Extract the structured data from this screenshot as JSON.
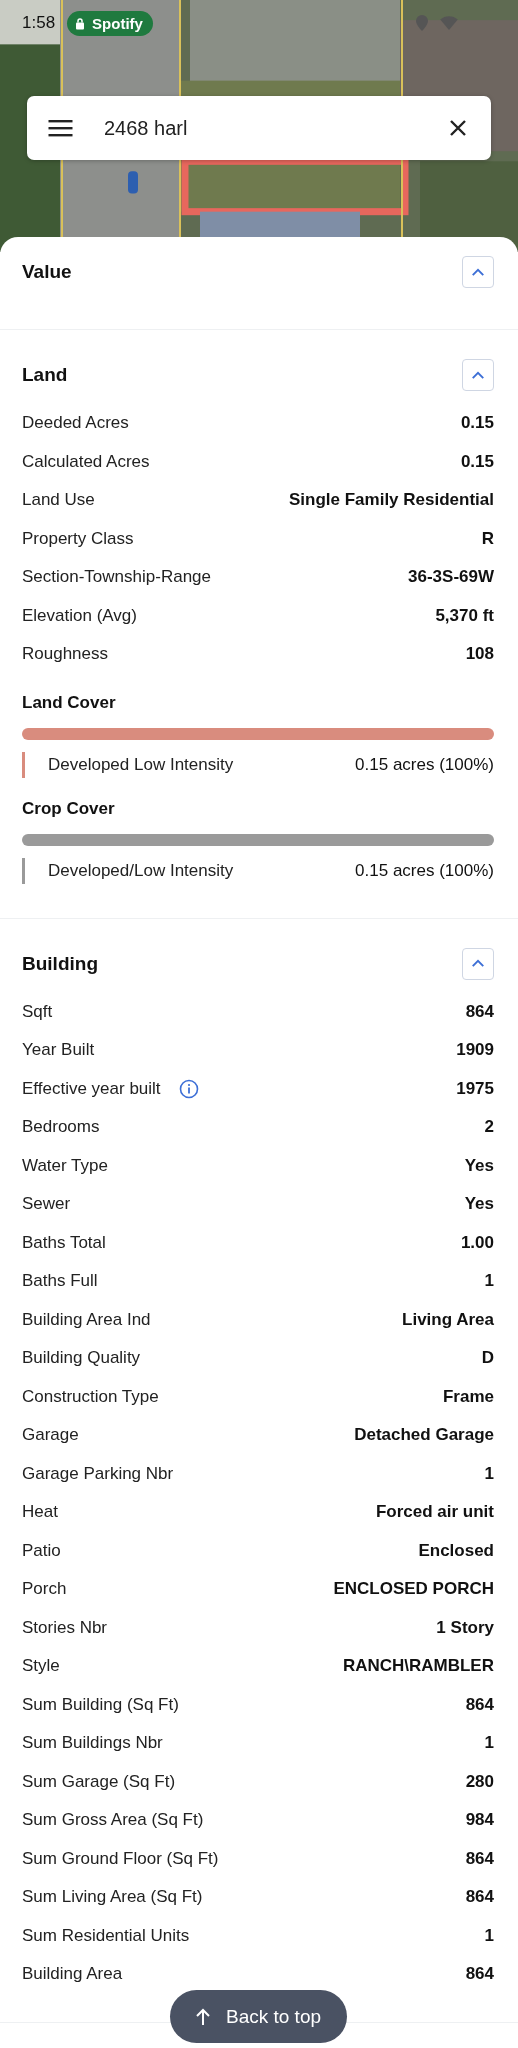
{
  "status_bar": {
    "time": "1:58",
    "app_chip": "Spotify"
  },
  "search": {
    "value": "2468 harl"
  },
  "sections": [
    {
      "title": "Value",
      "expanded": true
    },
    {
      "title": "Land",
      "expanded": true,
      "rows": [
        {
          "label": "Deeded Acres",
          "value": "0.15",
          "info": false
        },
        {
          "label": "Calculated Acres",
          "value": "0.15",
          "info": false
        },
        {
          "label": "Land Use",
          "value": "Single Family Residential",
          "info": false
        },
        {
          "label": "Property Class",
          "value": "R",
          "info": false
        },
        {
          "label": "Section-Township-Range",
          "value": "36-3S-69W",
          "info": false
        },
        {
          "label": "Elevation (Avg)",
          "value": "5,370 ft",
          "info": false
        },
        {
          "label": "Roughness",
          "value": "108",
          "info": false
        }
      ],
      "covers": [
        {
          "title": "Land Cover",
          "items": [
            {
              "name": "Developed Low Intensity",
              "amount": "0.15 acres (100%)",
              "level": 1,
              "color": "#d98c7e"
            }
          ]
        },
        {
          "title": "Crop Cover",
          "items": [
            {
              "name": "Developed/Low Intensity",
              "amount": "0.15 acres (100%)",
              "level": 1,
              "color": "#9a9a9a"
            }
          ]
        }
      ]
    },
    {
      "title": "Building",
      "expanded": true,
      "rows": [
        {
          "label": "Sqft",
          "value": "864",
          "info": false
        },
        {
          "label": "Year Built",
          "value": "1909",
          "info": false
        },
        {
          "label": "Effective year built",
          "value": "1975",
          "info": true
        },
        {
          "label": "Bedrooms",
          "value": "2",
          "info": false
        },
        {
          "label": "Water Type",
          "value": "Yes",
          "info": false
        },
        {
          "label": "Sewer",
          "value": "Yes",
          "info": false
        },
        {
          "label": "Baths Total",
          "value": "1.00",
          "info": false
        },
        {
          "label": "Baths Full",
          "value": "1",
          "info": false
        },
        {
          "label": "Building Area Ind",
          "value": "Living Area",
          "info": false
        },
        {
          "label": "Building Quality",
          "value": "D",
          "info": false
        },
        {
          "label": "Construction Type",
          "value": "Frame",
          "info": false
        },
        {
          "label": "Garage",
          "value": "Detached Garage",
          "info": false
        },
        {
          "label": "Garage Parking Nbr",
          "value": "1",
          "info": false
        },
        {
          "label": "Heat",
          "value": "Forced air unit",
          "info": false
        },
        {
          "label": "Patio",
          "value": "Enclosed",
          "info": false
        },
        {
          "label": "Porch",
          "value": "ENCLOSED PORCH",
          "info": false
        },
        {
          "label": "Stories Nbr",
          "value": "1 Story",
          "info": false
        },
        {
          "label": "Style",
          "value": "RANCH\\RAMBLER",
          "info": false
        },
        {
          "label": "Sum Building (Sq Ft)",
          "value": "864",
          "info": false
        },
        {
          "label": "Sum Buildings Nbr",
          "value": "1",
          "info": false
        },
        {
          "label": "Sum Garage (Sq Ft)",
          "value": "280",
          "info": false
        },
        {
          "label": "Sum Gross Area (Sq Ft)",
          "value": "984",
          "info": false
        },
        {
          "label": "Sum Ground Floor (Sq Ft)",
          "value": "864",
          "info": false
        },
        {
          "label": "Sum Living Area (Sq Ft)",
          "value": "864",
          "info": false
        },
        {
          "label": "Sum Residential Units",
          "value": "1",
          "info": false
        },
        {
          "label": "Building Area",
          "value": "864",
          "info": false
        }
      ]
    }
  ],
  "back_to_top": {
    "label": "Back to top"
  }
}
